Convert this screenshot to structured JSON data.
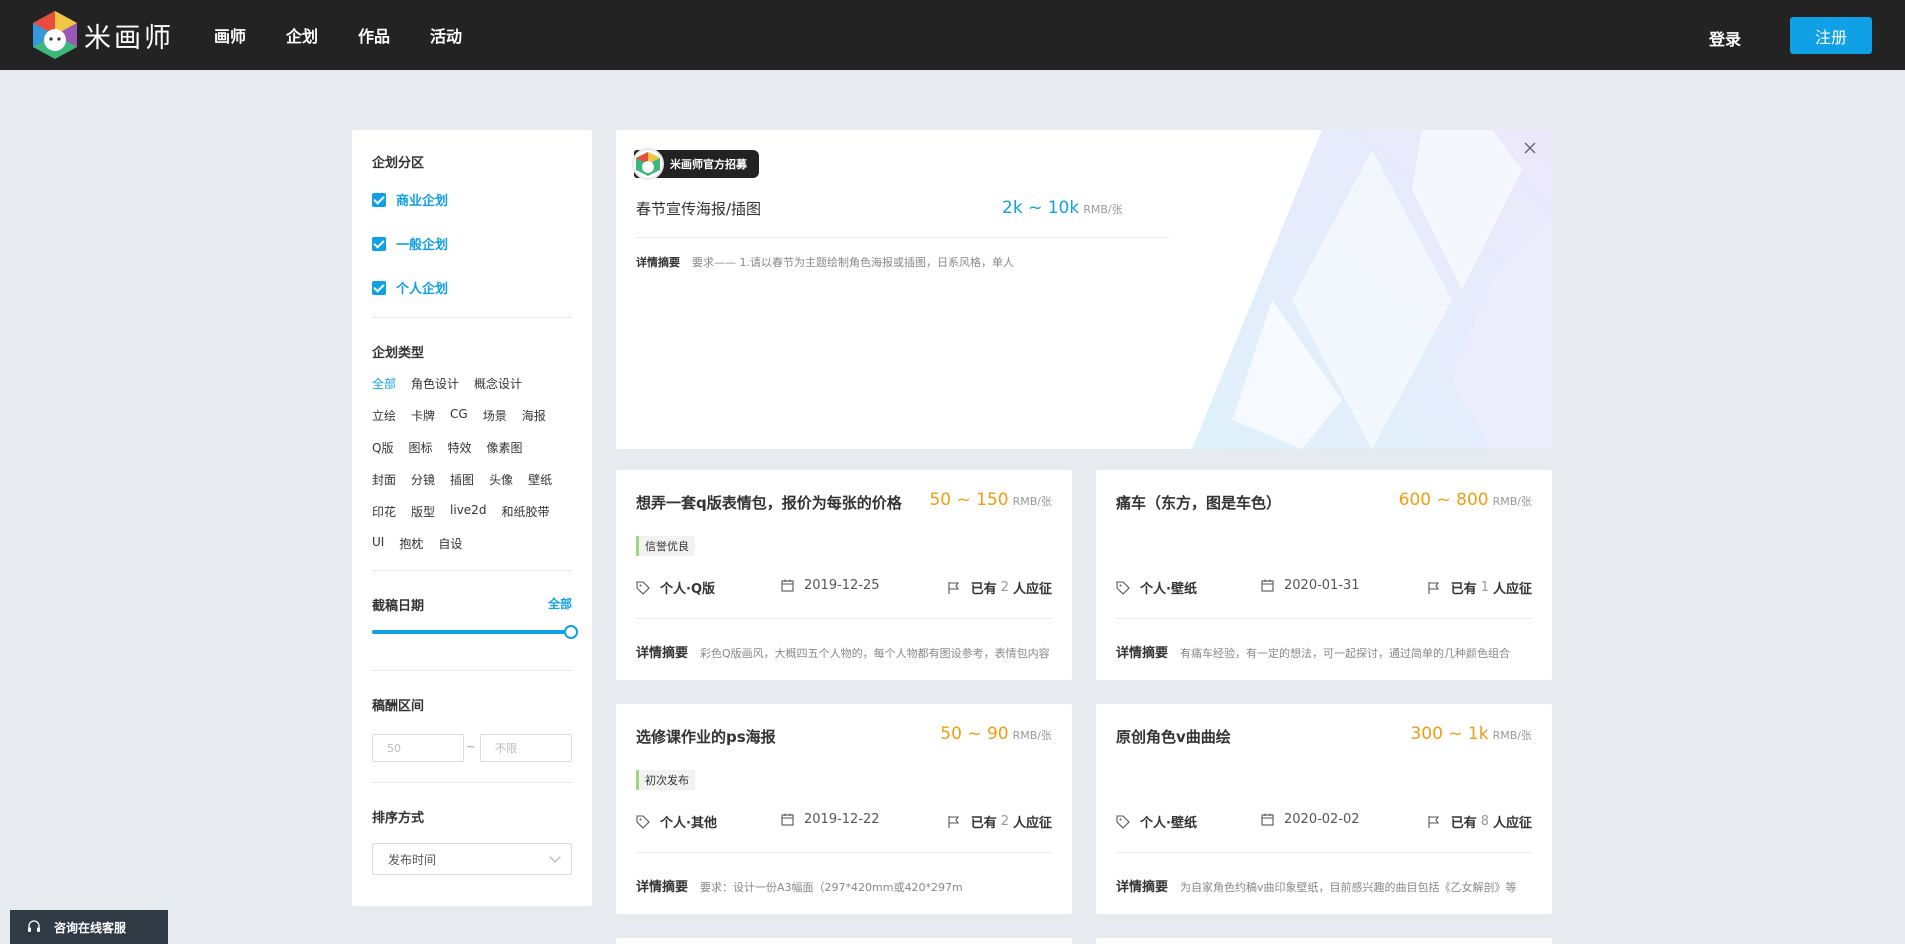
{
  "nav": {
    "brand": "米画师",
    "items": [
      "画师",
      "企划",
      "作品",
      "活动"
    ],
    "login": "登录",
    "register": "注册"
  },
  "sidebar": {
    "zone_title": "企划分区",
    "zones": [
      "商业企划",
      "一般企划",
      "个人企划"
    ],
    "type_title": "企划类型",
    "type_rows": [
      [
        "全部",
        "角色设计",
        "概念设计"
      ],
      [
        "立绘",
        "卡牌",
        "CG",
        "场景",
        "海报"
      ],
      [
        "Q版",
        "图标",
        "特效",
        "像素图"
      ],
      [
        "封面",
        "分镜",
        "插图",
        "头像",
        "壁纸"
      ],
      [
        "印花",
        "版型",
        "live2d",
        "和纸胶带"
      ],
      [
        "UI",
        "抱枕",
        "自设"
      ]
    ],
    "deadline_title": "截稿日期",
    "deadline_value": "全部",
    "deadline_level": 1.0,
    "fee_title": "稿酬区间",
    "fee_min_placeholder": "50",
    "fee_sep": "~",
    "fee_max_placeholder": "不限",
    "sort_title": "排序方式",
    "sort_value": "发布时间"
  },
  "featured": {
    "badge": "米画师官方招募",
    "title": "春节宣传海报/插图",
    "price": "2k ~ 10k",
    "unit": "RMB/张",
    "summary_label": "详情摘要",
    "summary": "要求—— 1.请以春节为主题绘制角色海报或插图，日系风格，单人"
  },
  "cards": [
    {
      "title": "想弄一套q版表情包，报价为每张的价格",
      "price": "50 ~ 150",
      "unit": "RMB/张",
      "tag": "信誉优良",
      "category": "个人·Q版",
      "date": "2019-12-25",
      "applicants_prefix": "已有",
      "applicants": "2",
      "applicants_suffix": "人应征",
      "summary_label": "详情摘要",
      "summary": "彩色Q版画风，大概四五个人物的，每个人物都有图设参考，表情包内容"
    },
    {
      "title": "痛车（东方，图是车色）",
      "price": "600 ~ 800",
      "unit": "RMB/张",
      "tag": "",
      "category": "个人·壁纸",
      "date": "2020-01-31",
      "applicants_prefix": "已有",
      "applicants": "1",
      "applicants_suffix": "人应征",
      "summary_label": "详情摘要",
      "summary": "有痛车经验，有一定的想法，可一起探讨，通过简单的几种颜色组合"
    },
    {
      "title": "选修课作业的ps海报",
      "price": "50 ~ 90",
      "unit": "RMB/张",
      "tag": "初次发布",
      "category": "个人·其他",
      "date": "2019-12-22",
      "applicants_prefix": "已有",
      "applicants": "2",
      "applicants_suffix": "人应征",
      "summary_label": "详情摘要",
      "summary": "要求：设计一份A3幅面（297*420mm或420*297m"
    },
    {
      "title": "原创角色v曲曲绘",
      "price": "300 ~ 1k",
      "unit": "RMB/张",
      "tag": "",
      "category": "个人·壁纸",
      "date": "2020-02-02",
      "applicants_prefix": "已有",
      "applicants": "8",
      "applicants_suffix": "人应征",
      "summary_label": "详情摘要",
      "summary": "为自家角色约稿v曲印象壁纸，目前感兴趣的曲目包括《乙女解剖》等"
    }
  ],
  "help": "咨询在线客服",
  "colors": {
    "accent": "#0fa0e6",
    "price": "#f39c12",
    "topbar": "#232323"
  }
}
